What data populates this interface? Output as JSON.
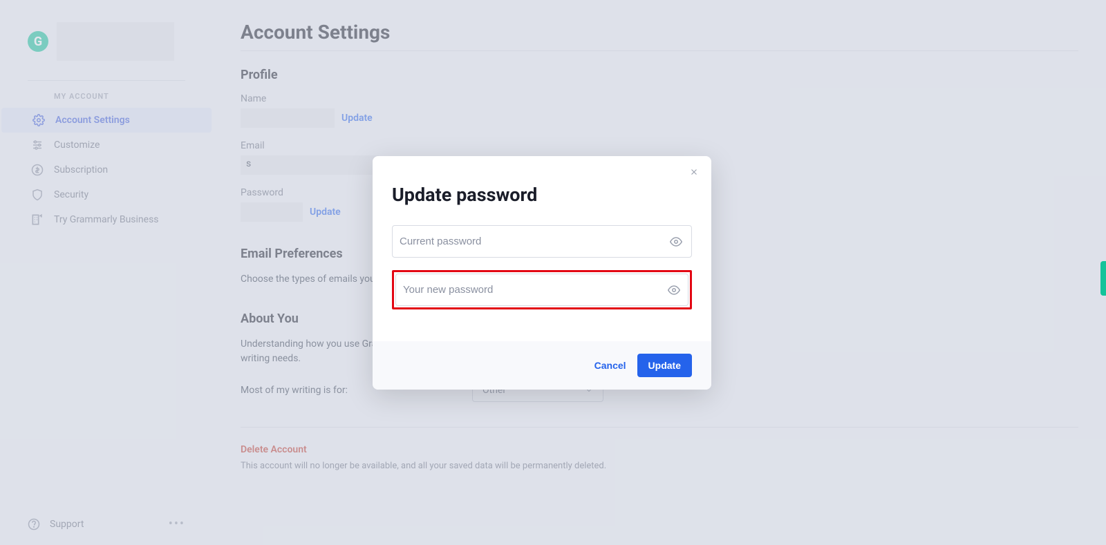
{
  "logo_letter": "G",
  "sidebar": {
    "header": "MY ACCOUNT",
    "items": [
      {
        "label": "Account Settings"
      },
      {
        "label": "Customize"
      },
      {
        "label": "Subscription"
      },
      {
        "label": "Security"
      },
      {
        "label": "Try Grammarly Business"
      }
    ],
    "support": "Support"
  },
  "page": {
    "title": "Account Settings",
    "profile": {
      "title": "Profile",
      "name_label": "Name",
      "name_update": "Update",
      "email_label": "Email",
      "email_prefix": "s",
      "password_label": "Password",
      "password_update": "Update"
    },
    "email_prefs": {
      "title": "Email Preferences",
      "desc": "Choose the types of emails you"
    },
    "about": {
      "title": "About You",
      "desc": "Understanding how you use Grammarly helps us develop features tailored to your writing needs.",
      "select_label": "Most of my writing is for:",
      "select_value": "Other"
    },
    "delete": {
      "title": "Delete Account",
      "desc": "This account will no longer be available, and all your saved data will be permanently deleted."
    }
  },
  "modal": {
    "title": "Update password",
    "current_placeholder": "Current password",
    "new_placeholder": "Your new password",
    "cancel": "Cancel",
    "update": "Update"
  }
}
